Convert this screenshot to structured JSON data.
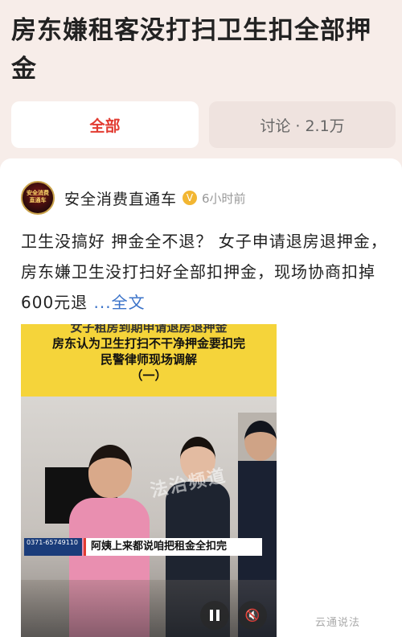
{
  "header": {
    "title": "房东嫌租客没打扫卫生扣全部押金"
  },
  "tabs": [
    {
      "label": "全部",
      "active": true
    },
    {
      "label": "讨论 · 2.1万",
      "active": false
    }
  ],
  "post": {
    "author": "安全消费直通车",
    "avatar_text": "安全消费直通车",
    "verified_icon": "verified-badge-icon",
    "time": "6小时前",
    "content": "卫生没搞好 押金全不退？ 女子申请退房退押金，房东嫌卫生没打扫好全部扣押金，现场协商扣掉600元退 ",
    "more_label": "...全文",
    "video": {
      "banner_lines": [
        "女子租房到期申请退房退押金",
        "房东认为卫生打扫不干净押金要扣完",
        "民警律师现场调解",
        "（一）"
      ],
      "watermark": "法治频道",
      "hotline": "0371-65749110",
      "subtitle": "阿姨上来都说咱把租金全扣完",
      "pause_icon": "pause-icon",
      "mute_icon": "mute-icon"
    }
  },
  "footer": {
    "brand": "云通说法"
  },
  "colors": {
    "accent": "#e23c32",
    "link": "#3b73c9",
    "banner": "#f5d43a",
    "background": "#f7ede9"
  }
}
